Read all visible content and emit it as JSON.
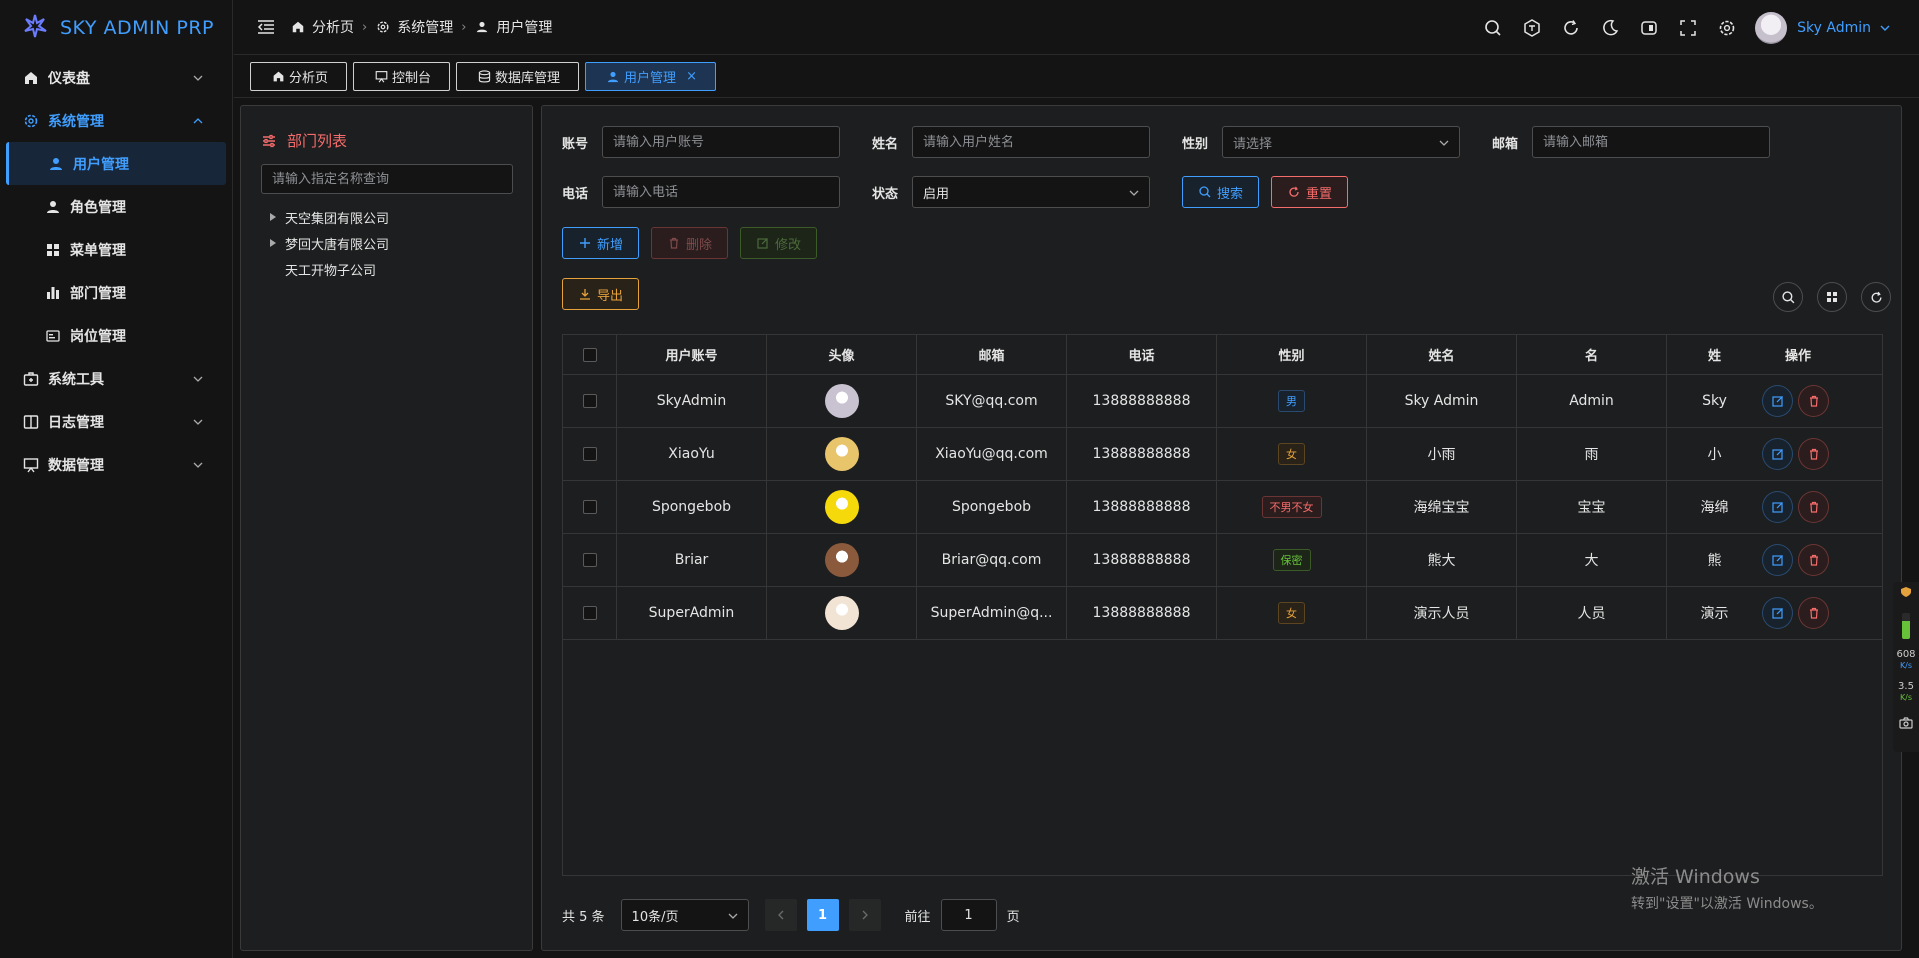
{
  "brand": {
    "name": "SKY ADMIN PRP",
    "accent": "#409eff"
  },
  "sidebar": {
    "items": [
      {
        "label": "仪表盘",
        "icon": "home-icon",
        "expanded": false
      },
      {
        "label": "系统管理",
        "icon": "gear-icon",
        "expanded": true,
        "children": [
          {
            "label": "用户管理",
            "icon": "user-icon",
            "active": true
          },
          {
            "label": "角色管理",
            "icon": "role-icon"
          },
          {
            "label": "菜单管理",
            "icon": "grid-icon"
          },
          {
            "label": "部门管理",
            "icon": "bar-chart-icon"
          },
          {
            "label": "岗位管理",
            "icon": "id-card-icon"
          }
        ]
      },
      {
        "label": "系统工具",
        "icon": "toolbox-icon",
        "expanded": false
      },
      {
        "label": "日志管理",
        "icon": "book-icon",
        "expanded": false
      },
      {
        "label": "数据管理",
        "icon": "presentation-icon",
        "expanded": false
      }
    ]
  },
  "header": {
    "breadcrumb": [
      {
        "label": "分析页",
        "icon": "home-icon"
      },
      {
        "label": "系统管理",
        "icon": "gear-icon"
      },
      {
        "label": "用户管理",
        "icon": "user-icon"
      }
    ],
    "icons": [
      "search-icon",
      "translate-icon",
      "refresh-icon",
      "moon-icon",
      "layout-icon",
      "fullscreen-icon",
      "settings-icon"
    ],
    "user": "Sky Admin"
  },
  "tabs": [
    {
      "label": "分析页",
      "icon": "home-icon"
    },
    {
      "label": "控制台",
      "icon": "presentation-icon"
    },
    {
      "label": "数据库管理",
      "icon": "database-icon"
    },
    {
      "label": "用户管理",
      "icon": "user-icon",
      "active": true,
      "closable": true,
      "close": "×"
    }
  ],
  "dept": {
    "title": "部门列表",
    "search_placeholder": "请输入指定名称查询",
    "nodes": [
      {
        "label": "天空集团有限公司",
        "expandable": true
      },
      {
        "label": "梦回大唐有限公司",
        "expandable": true
      },
      {
        "label": "天工开物子公司",
        "expandable": false
      }
    ]
  },
  "filters": {
    "account": {
      "label": "账号",
      "placeholder": "请输入用户账号"
    },
    "name": {
      "label": "姓名",
      "placeholder": "请输入用户姓名"
    },
    "gender": {
      "label": "性别",
      "placeholder": "请选择"
    },
    "email": {
      "label": "邮箱",
      "placeholder": "请输入邮箱"
    },
    "phone": {
      "label": "电话",
      "placeholder": "请输入电话"
    },
    "status": {
      "label": "状态",
      "value": "启用"
    },
    "search_btn": "搜索",
    "reset_btn": "重置"
  },
  "actions": {
    "add": "新增",
    "delete": "删除",
    "edit": "修改",
    "export": "导出"
  },
  "table": {
    "columns": [
      "用户账号",
      "头像",
      "邮箱",
      "电话",
      "性别",
      "姓名",
      "名",
      "姓",
      "操作"
    ],
    "rows": [
      {
        "account": "SkyAdmin",
        "email": "SKY@qq.com",
        "phone": "13888888888",
        "gender": "男",
        "gender_type": "male",
        "name": "Sky Admin",
        "first": "Admin",
        "last": "Sky",
        "avatar_color": "#c9c3d1"
      },
      {
        "account": "XiaoYu",
        "email": "XiaoYu@qq.com",
        "phone": "13888888888",
        "gender": "女",
        "gender_type": "female",
        "name": "小雨",
        "first": "雨",
        "last": "小",
        "avatar_color": "#e8c46a"
      },
      {
        "account": "Spongebob",
        "email": "Spongebob",
        "phone": "13888888888",
        "gender": "不男不女",
        "gender_type": "other",
        "name": "海绵宝宝",
        "first": "宝宝",
        "last": "海绵",
        "avatar_color": "#f5d90a"
      },
      {
        "account": "Briar",
        "email": "Briar@qq.com",
        "phone": "13888888888",
        "gender": "保密",
        "gender_type": "secret",
        "name": "熊大",
        "first": "大",
        "last": "熊",
        "avatar_color": "#8b5a3c"
      },
      {
        "account": "SuperAdmin",
        "email": "SuperAdmin@q...",
        "phone": "13888888888",
        "gender": "女",
        "gender_type": "female",
        "name": "演示人员",
        "first": "人员",
        "last": "演示",
        "avatar_color": "#f2e4d4"
      }
    ]
  },
  "pagination": {
    "total": "共 5 条",
    "page_size": "10条/页",
    "current": "1",
    "goto_label": "前往",
    "goto_value": "1",
    "page_suffix": "页"
  },
  "watermark": {
    "line1": "激活 Windows",
    "line2": "转到\"设置\"以激活 Windows。"
  },
  "side_widget": {
    "up": "608",
    "up_unit": "K/s",
    "down": "3.5",
    "down_unit": "K/s"
  }
}
